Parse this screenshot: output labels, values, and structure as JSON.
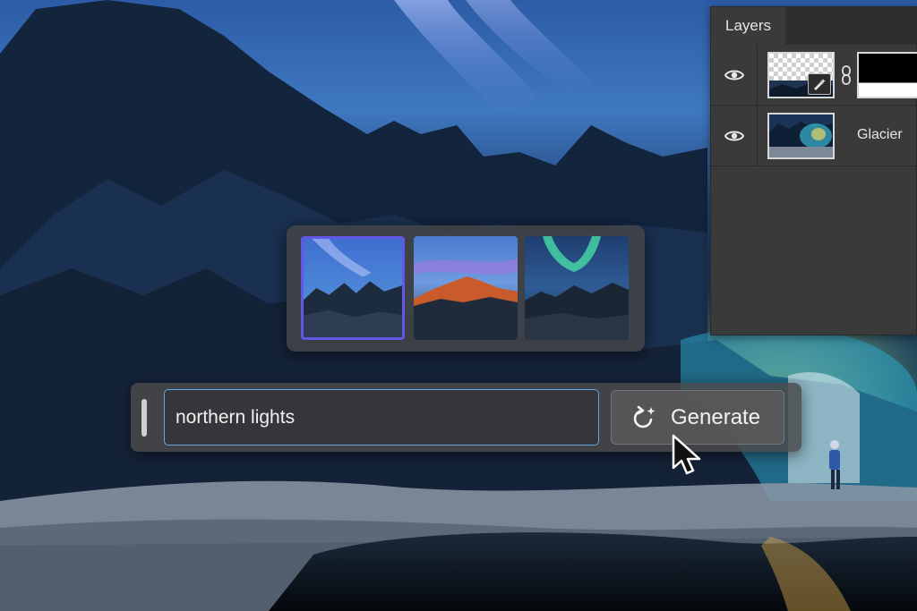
{
  "layers_panel": {
    "tab_label": "Layers",
    "layers": [
      {
        "name": "",
        "type": "generative-fill",
        "visible": true,
        "icons": [
          "eye-icon",
          "generative-badge-icon",
          "link-icon"
        ]
      },
      {
        "name": "Glacier",
        "type": "image",
        "visible": true,
        "icons": [
          "eye-icon"
        ]
      }
    ]
  },
  "variations": {
    "items": [
      {
        "label": "variation-1",
        "selected": true
      },
      {
        "label": "variation-2",
        "selected": false
      },
      {
        "label": "variation-3",
        "selected": false
      }
    ],
    "accent": "#6257e6"
  },
  "prompt_bar": {
    "input_value": "northern lights",
    "generate_label": "Generate",
    "generate_icon": "generate-refresh-sparkle-icon",
    "input_focus_color": "#5fa8e0"
  }
}
